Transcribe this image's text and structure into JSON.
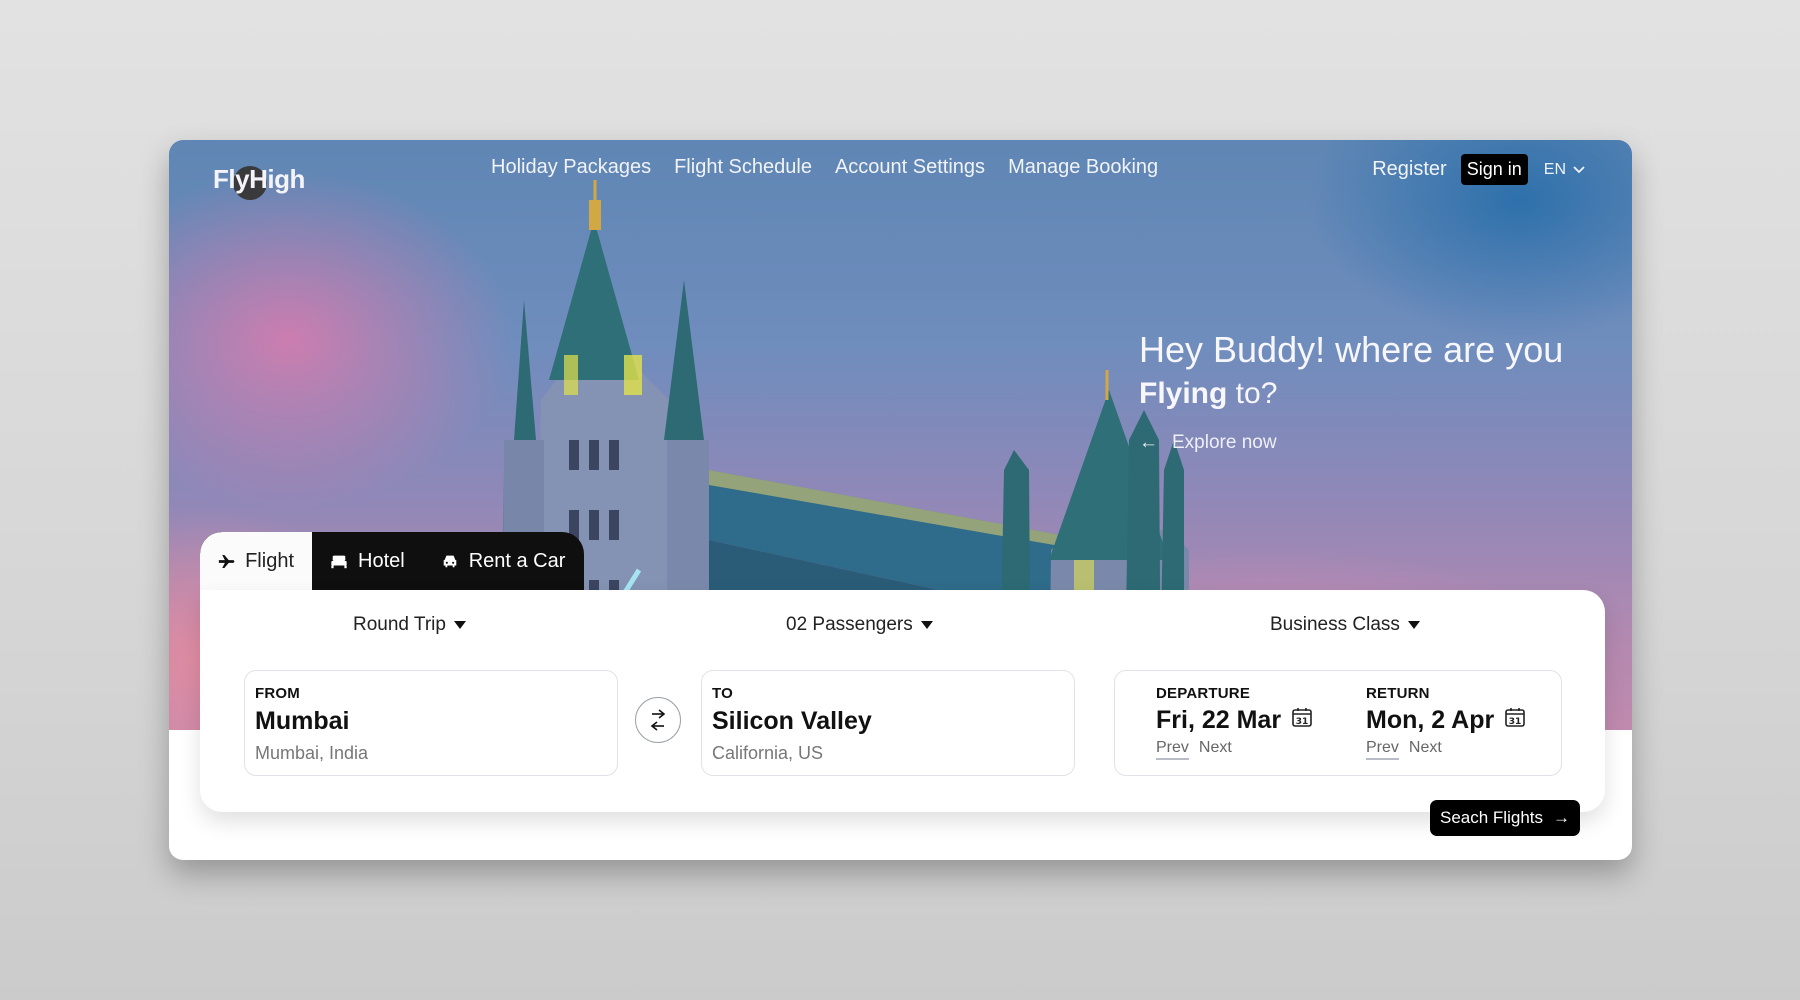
{
  "header": {
    "logo": {
      "part1": "Fly",
      "part2": "High"
    },
    "nav": [
      {
        "label": "Holiday Packages"
      },
      {
        "label": "Flight Schedule"
      },
      {
        "label": "Account Settings"
      },
      {
        "label": "Manage Booking"
      }
    ],
    "register_label": "Register",
    "signin_label": "Sign in",
    "language": "EN"
  },
  "hero": {
    "headline_line1": "Hey Buddy! where are you",
    "headline_bold": "Flying",
    "headline_rest": " to?",
    "explore_arrow": "←",
    "explore_label": "Explore now"
  },
  "tabs": [
    {
      "label": "Flight",
      "icon": "airplane-icon",
      "active": true
    },
    {
      "label": "Hotel",
      "icon": "bed-icon",
      "active": false
    },
    {
      "label": "Rent a Car",
      "icon": "car-icon",
      "active": false
    }
  ],
  "search": {
    "trip_type": "Round Trip",
    "passengers": "02 Passengers",
    "cabin_class": "Business Class",
    "from": {
      "label": "FROM",
      "city": "Mumbai",
      "detail": "Mumbai, India"
    },
    "to": {
      "label": "TO",
      "city": "Silicon Valley",
      "detail": "California, US"
    },
    "departure": {
      "label": "DEPARTURE",
      "date": "Fri, 22 Mar",
      "prev": "Prev",
      "next": "Next"
    },
    "return": {
      "label": "RETURN",
      "date": "Mon, 2 Apr",
      "prev": "Prev",
      "next": "Next"
    },
    "calendar_day": "31",
    "submit_label": "Seach Flights",
    "submit_arrow": "→"
  },
  "colors": {
    "primary_dark": "#000000",
    "hero_blue": "#5f86b4",
    "hero_pink": "#c08aae"
  }
}
